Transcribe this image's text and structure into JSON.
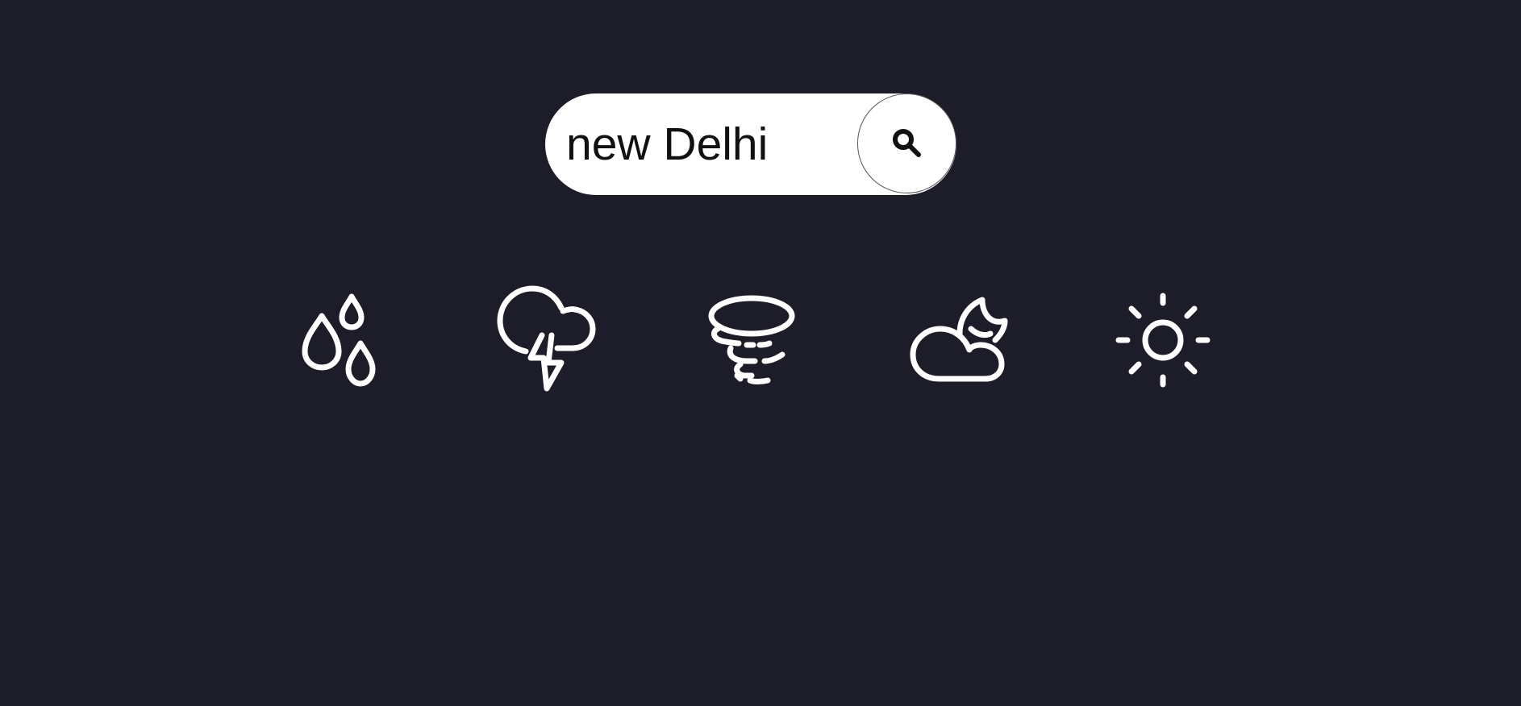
{
  "search": {
    "value": "new Delhi",
    "button_icon": "search-icon"
  },
  "weather_icons": [
    {
      "name": "raindrops-icon"
    },
    {
      "name": "thunderstorm-icon"
    },
    {
      "name": "tornado-icon"
    },
    {
      "name": "cloudy-night-icon"
    },
    {
      "name": "sun-icon"
    }
  ],
  "colors": {
    "background": "#1d1d2a",
    "icon": "#ffffff",
    "search_bar": "#ffffff",
    "text": "#111111"
  }
}
